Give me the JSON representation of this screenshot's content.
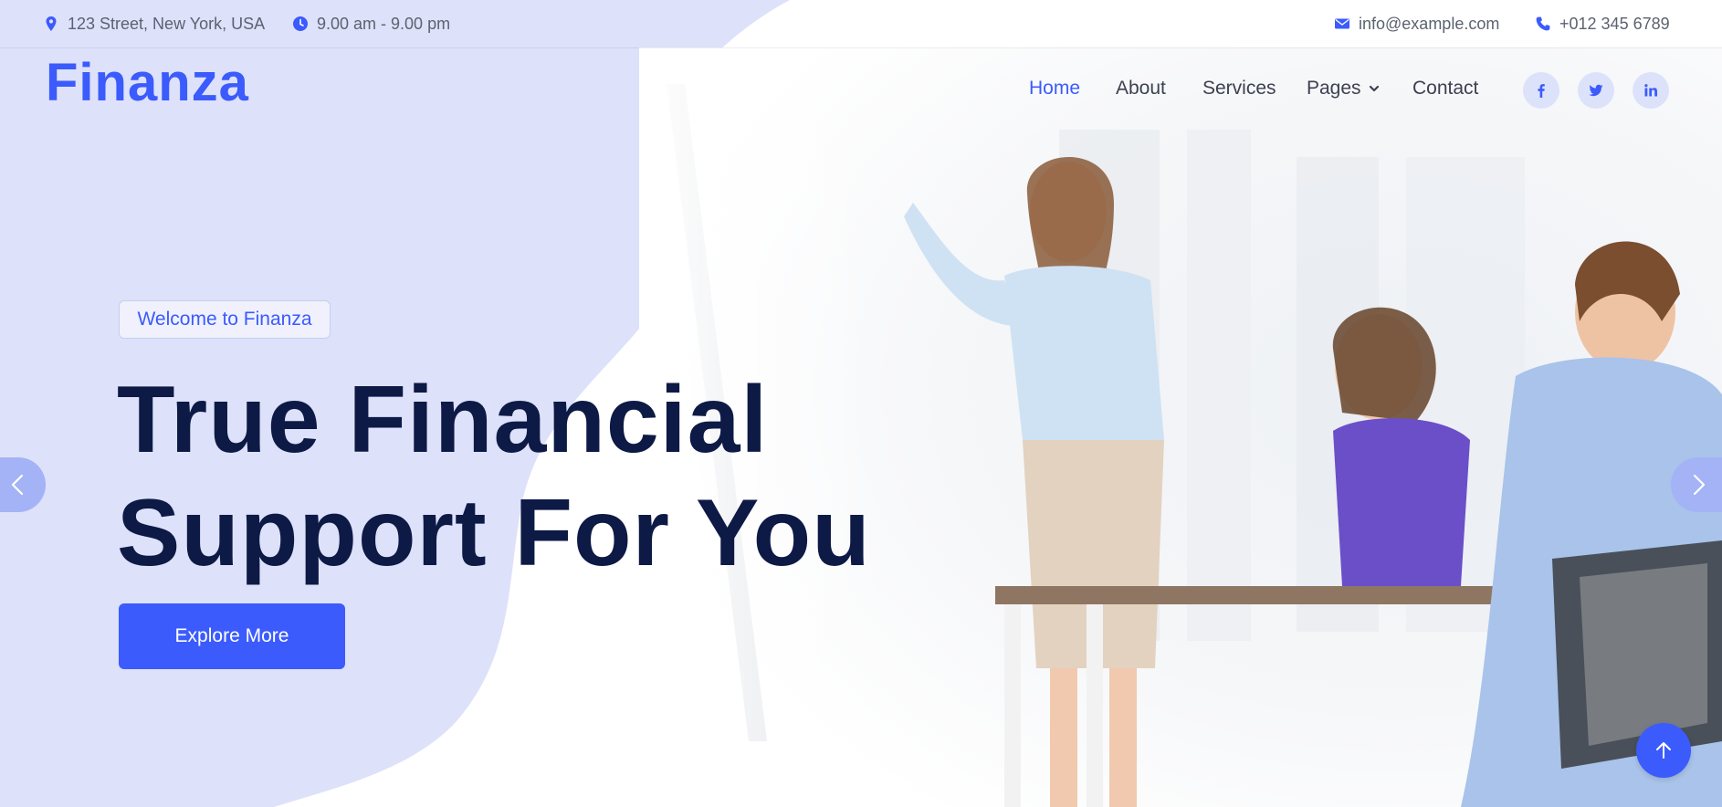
{
  "topbar": {
    "address": "123 Street, New York, USA",
    "hours": "9.00 am - 9.00 pm",
    "email": "info@example.com",
    "phone": "+012 345 6789"
  },
  "brand": {
    "logo": "Finanza"
  },
  "nav": {
    "items": [
      {
        "label": "Home",
        "active": true
      },
      {
        "label": "About",
        "active": false
      },
      {
        "label": "Services",
        "active": false
      },
      {
        "label": "Pages",
        "active": false,
        "dropdown": true
      },
      {
        "label": "Contact",
        "active": false
      }
    ],
    "social": [
      {
        "icon": "facebook-icon"
      },
      {
        "icon": "twitter-icon"
      },
      {
        "icon": "linkedin-icon"
      }
    ]
  },
  "hero": {
    "badge": "Welcome to Finanza",
    "headline_line1": "True Financial",
    "headline_line2": "Support For You",
    "cta_label": "Explore More"
  },
  "carousel": {
    "prev_icon": "chevron-left-icon",
    "next_icon": "chevron-right-icon"
  },
  "colors": {
    "accent": "#3b5bfd",
    "headline": "#0d1a45",
    "blob": "#dde1fa"
  }
}
